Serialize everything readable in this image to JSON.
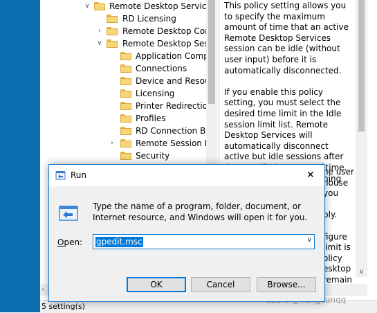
{
  "tree": {
    "items": [
      {
        "label": "Remote Desktop Services",
        "expanded": true,
        "has_children": true
      },
      {
        "label": "RD Licensing",
        "expanded": false,
        "has_children": false
      },
      {
        "label": "Remote Desktop Conn",
        "expanded": false,
        "has_children": true
      },
      {
        "label": "Remote Desktop Sessio",
        "expanded": true,
        "has_children": true
      },
      {
        "label": "Application Compa",
        "expanded": false,
        "has_children": false
      },
      {
        "label": "Connections",
        "expanded": false,
        "has_children": false
      },
      {
        "label": "Device and Resour",
        "expanded": false,
        "has_children": false
      },
      {
        "label": "Licensing",
        "expanded": false,
        "has_children": false
      },
      {
        "label": "Printer Redirection",
        "expanded": false,
        "has_children": false
      },
      {
        "label": "Profiles",
        "expanded": false,
        "has_children": false
      },
      {
        "label": "RD Connection Bro",
        "expanded": false,
        "has_children": false
      },
      {
        "label": "Remote Session En",
        "expanded": false,
        "has_children": true
      },
      {
        "label": "Security",
        "expanded": false,
        "has_children": false
      }
    ]
  },
  "description": {
    "paragraphs": [
      "This policy setting allows you to specify the maximum amount of time that an active Remote Desktop Services session can be idle (without user input) before it is automatically disconnected.",
      "If you enable this policy setting, you must select the desired time limit in the Idle session limit list. Remote Desktop Services will automatically disconnect active but idle sessions after the specified amount of time. The user receives a warning two minutes before the session"
    ],
    "partial_lines": [
      "he user",
      "nouse",
      "you",
      "",
      "ply.",
      "",
      "figure",
      "limit is",
      "olicy",
      "esktop",
      "remain"
    ]
  },
  "status": {
    "text": "5 setting(s)"
  },
  "run_dialog": {
    "title": "Run",
    "close_glyph": "✕",
    "description": "Type the name of a program, folder, document, or Internet resource, and Windows will open it for you.",
    "open_label": "pen:",
    "open_label_accel": "O",
    "open_value": "gpedit.msc",
    "ok_label": "OK",
    "cancel_label": "Cancel",
    "browse_label": "Browse..."
  },
  "watermark": "CSDN @nongcunqq"
}
